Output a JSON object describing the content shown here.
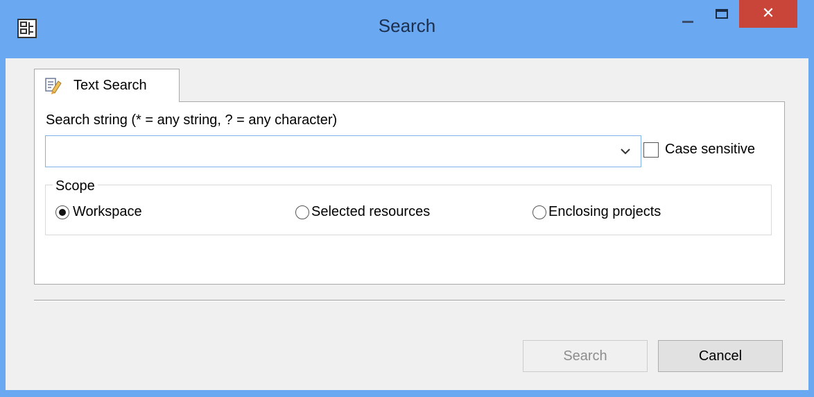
{
  "window": {
    "title": "Search",
    "close_symbol": "✕",
    "icons": [
      "search-dialog-app-icon",
      "minimize-icon",
      "maximize-icon",
      "close-icon"
    ]
  },
  "tabs": [
    {
      "label": "Text Search",
      "icon": "text-search-icon",
      "active": true
    }
  ],
  "search": {
    "label": "Search string (* = any string, ? = any character)",
    "value": "",
    "case_sensitive_label": "Case sensitive",
    "case_sensitive_checked": false
  },
  "scope": {
    "label": "Scope",
    "options": [
      {
        "label": "Workspace",
        "selected": true
      },
      {
        "label": "Selected resources",
        "selected": false
      },
      {
        "label": "Enclosing projects",
        "selected": false
      }
    ]
  },
  "buttons": {
    "search_label": "Search",
    "search_enabled": false,
    "cancel_label": "Cancel"
  },
  "colors": {
    "titlebar": "#6aa8f2",
    "close_button": "#c9453a",
    "input_border": "#7fb2ea"
  }
}
